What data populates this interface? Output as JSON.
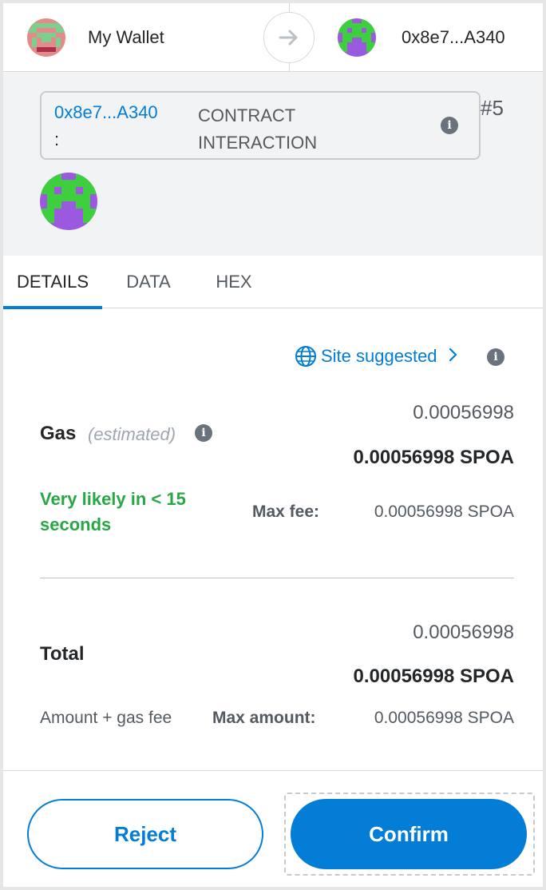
{
  "header": {
    "from_account": "My Wallet",
    "to_account": "0x8e7...A340",
    "arrow_icon": "arrow-right-icon"
  },
  "summary": {
    "contract_address": "0x8e7...A340",
    "contract_colon": ":",
    "contract_label": "CONTRACT INTERACTION",
    "nonce": "#5",
    "info_icon": "info-icon"
  },
  "tabs": [
    {
      "label": "DETAILS",
      "active": true
    },
    {
      "label": "DATA",
      "active": false
    },
    {
      "label": "HEX",
      "active": false
    }
  ],
  "details": {
    "site_suggested": "Site suggested",
    "gas_label": "Gas",
    "gas_estimated": "(estimated)",
    "gas_fiat": "0.00056998",
    "gas_native": "0.00056998 SPOA",
    "likely": "Very likely in < 15 seconds",
    "max_fee_label": "Max fee:",
    "max_fee_value": "0.00056998 SPOA",
    "total_label": "Total",
    "total_fiat": "0.00056998",
    "total_native": "0.00056998 SPOA",
    "amount_gas_label": "Amount + gas fee",
    "max_amount_label": "Max amount:",
    "max_amount_value": "0.00056998 SPOA"
  },
  "footer": {
    "reject_label": "Reject",
    "confirm_label": "Confirm"
  },
  "colors": {
    "primary": "#037dd6",
    "success": "#28a745",
    "summary_bg": "#f2f3f4"
  }
}
